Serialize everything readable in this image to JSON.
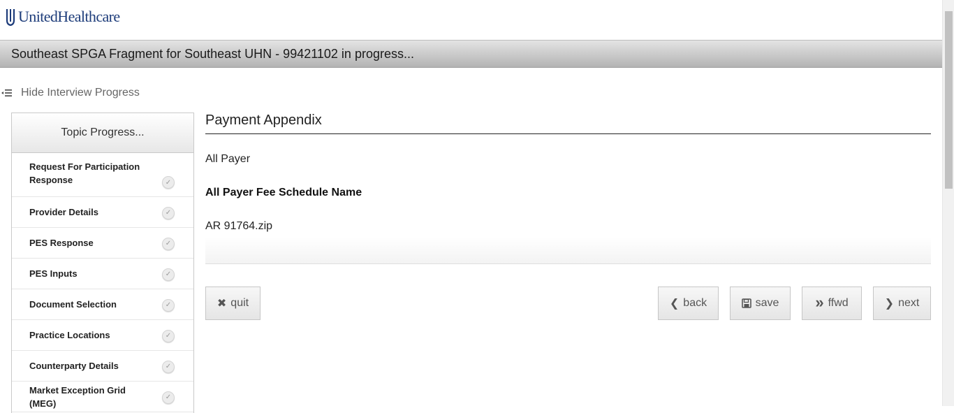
{
  "brand": {
    "name": "UnitedHealthcare",
    "color": "#1d3c7a"
  },
  "titlebar": {
    "title": "Southeast SPGA Fragment for Southeast UHN - 99421102 in progress..."
  },
  "toggle": {
    "icon": "hide-menu-icon",
    "label": "Hide Interview Progress"
  },
  "sidebar": {
    "heading": "Topic Progress...",
    "topics": [
      {
        "label": "Request For Participation Response",
        "status_icon": "check-icon"
      },
      {
        "label": "Provider Details",
        "status_icon": "check-icon"
      },
      {
        "label": "PES Response",
        "status_icon": "check-icon"
      },
      {
        "label": "PES Inputs",
        "status_icon": "check-icon"
      },
      {
        "label": "Document Selection",
        "status_icon": "check-icon"
      },
      {
        "label": "Practice Locations",
        "status_icon": "check-icon"
      },
      {
        "label": "Counterparty Details",
        "status_icon": "check-icon"
      },
      {
        "label": "Market Exception Grid (MEG)",
        "status_icon": "check-icon"
      }
    ]
  },
  "main": {
    "heading": "Payment Appendix",
    "payer": "All Payer",
    "fee_schedule_label": "All Payer Fee Schedule Name",
    "fee_schedule_value": "AR 91764.zip"
  },
  "buttons": {
    "quit": {
      "label": "quit",
      "icon": "close-icon",
      "glyph": "✖"
    },
    "back": {
      "label": "back",
      "icon": "chevron-left-icon",
      "glyph": "❮"
    },
    "save": {
      "label": "save",
      "icon": "floppy-disk-icon",
      "glyph": "💾"
    },
    "ffwd": {
      "label": "ffwd",
      "icon": "double-chevron-right-icon",
      "glyph": "»"
    },
    "next": {
      "label": "next",
      "icon": "chevron-right-icon",
      "glyph": "❯"
    }
  }
}
